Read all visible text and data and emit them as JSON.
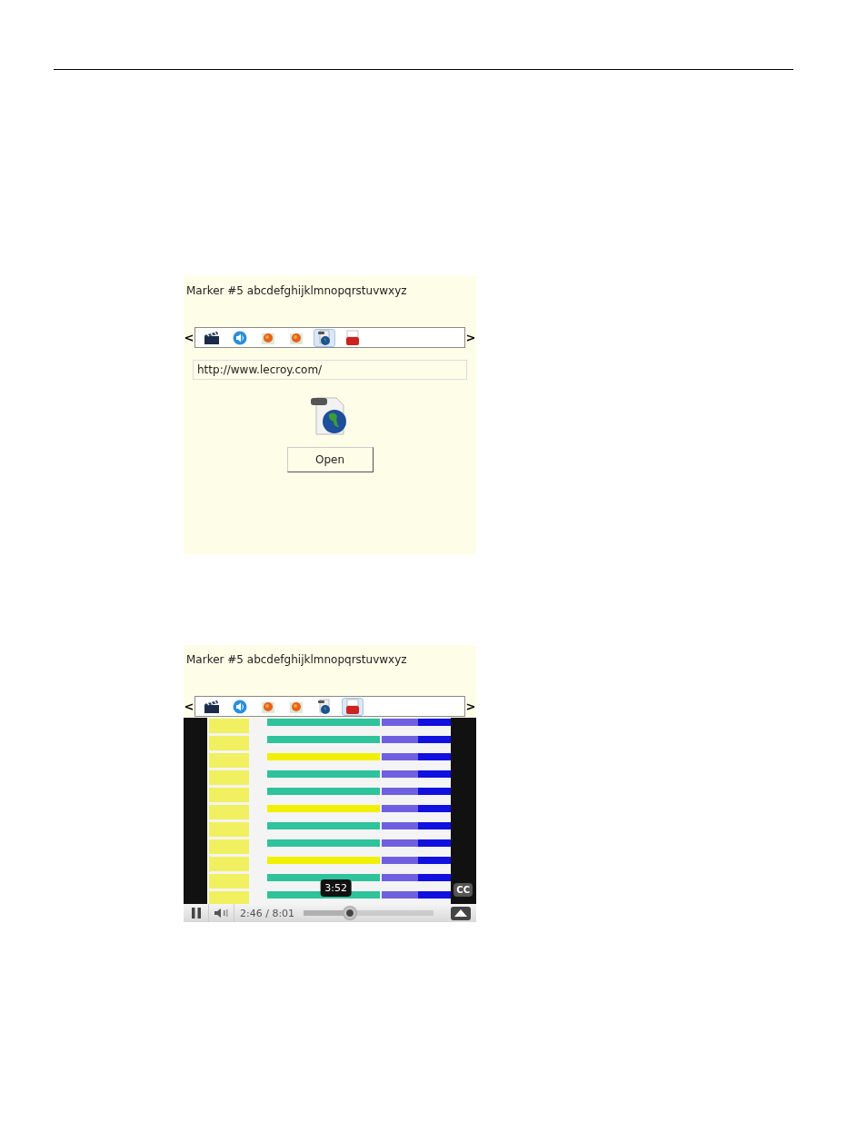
{
  "panels": [
    {
      "marker": "Marker #5 abcdefghijklmnopqrstuvwxyz",
      "prev": "<",
      "next": ">",
      "tabs": [
        {
          "kind": "clapper",
          "selected": false
        },
        {
          "kind": "speaker",
          "selected": false
        },
        {
          "kind": "ball",
          "selected": false
        },
        {
          "kind": "ball",
          "selected": false
        },
        {
          "kind": "url",
          "selected": true
        },
        {
          "kind": "video",
          "selected": false
        }
      ],
      "content": {
        "kind": "link",
        "url": "http://www.lecroy.com/",
        "button": "Open"
      }
    },
    {
      "marker": "Marker #5 abcdefghijklmnopqrstuvwxyz",
      "prev": "<",
      "next": ">",
      "tabs": [
        {
          "kind": "clapper",
          "selected": false
        },
        {
          "kind": "speaker",
          "selected": false
        },
        {
          "kind": "ball",
          "selected": false
        },
        {
          "kind": "ball",
          "selected": false
        },
        {
          "kind": "url",
          "selected": false
        },
        {
          "kind": "video",
          "selected": true
        }
      ],
      "content": {
        "kind": "video",
        "tooltip": "3:52",
        "time": "2:46 / 8:01",
        "playing": true,
        "level": 0.34,
        "cc": "CC"
      }
    }
  ]
}
